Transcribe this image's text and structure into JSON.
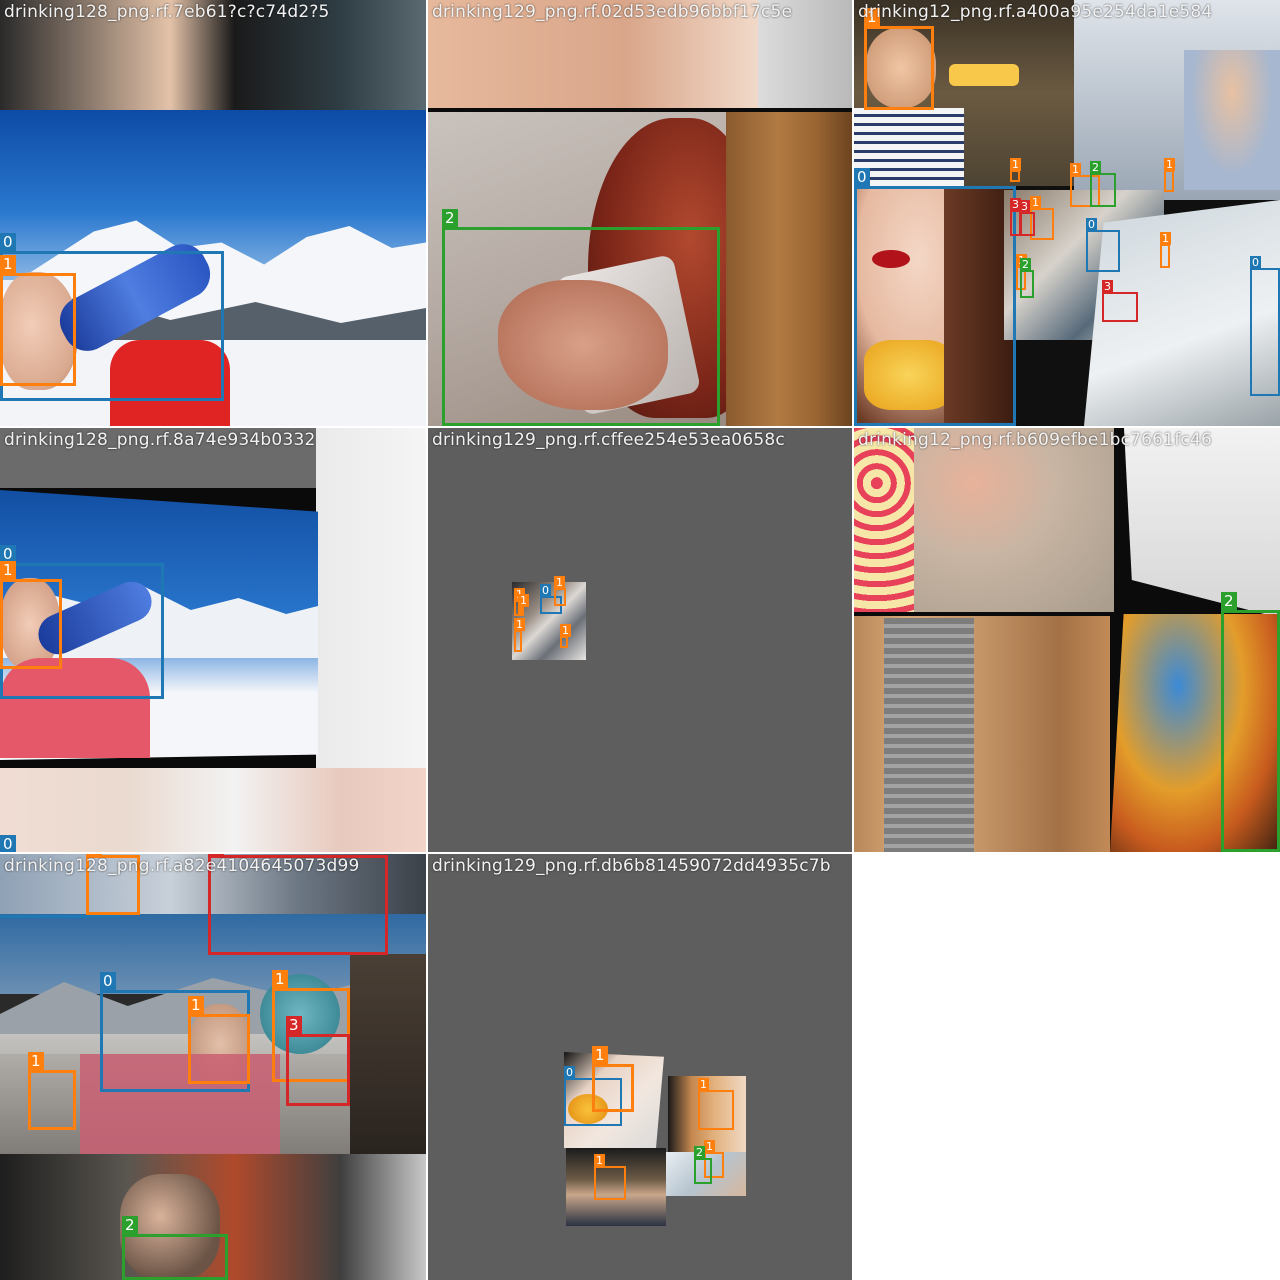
{
  "tiles": [
    {
      "title": "drinking128_png.rf.7eb61?c?c74d2?5",
      "labels": [
        "0",
        "1"
      ]
    },
    {
      "title": "drinking129_png.rf.02d53edb96bbf17c5e",
      "labels": [
        "2"
      ]
    },
    {
      "title": "drinking12_png.rf.a400a95e254da1e584",
      "labels": [
        "1",
        "0",
        "1",
        "1",
        "2",
        "1",
        "1",
        "3",
        "0",
        "1",
        "3",
        "1",
        "2",
        "3",
        "0"
      ]
    },
    {
      "title": "drinking128_png.rf.8a74e934b0332",
      "labels": [
        "0",
        "1",
        "0"
      ]
    },
    {
      "title": "drinking129_png.rf.cffee254e53ea0658c",
      "labels": [
        "1",
        "0",
        "1",
        "1",
        "1",
        "1"
      ]
    },
    {
      "title": "drinking12_png.rf.b609efbe1bc7661fc46",
      "labels": [
        "2"
      ]
    },
    {
      "title": "drinking128_png.rf.a82e4104645073d99",
      "labels": [
        "1",
        "3",
        "0",
        "1",
        "1",
        "3",
        "1",
        "2"
      ]
    },
    {
      "title": "drinking129_png.rf.db6b81459072dd4935c7b",
      "labels": [
        "0",
        "1",
        "1",
        "1",
        "2",
        "1"
      ]
    }
  ],
  "class_colors": {
    "0": "#1f77b4",
    "1": "#ff7f0e",
    "2": "#2ca02c",
    "3": "#d62728"
  }
}
